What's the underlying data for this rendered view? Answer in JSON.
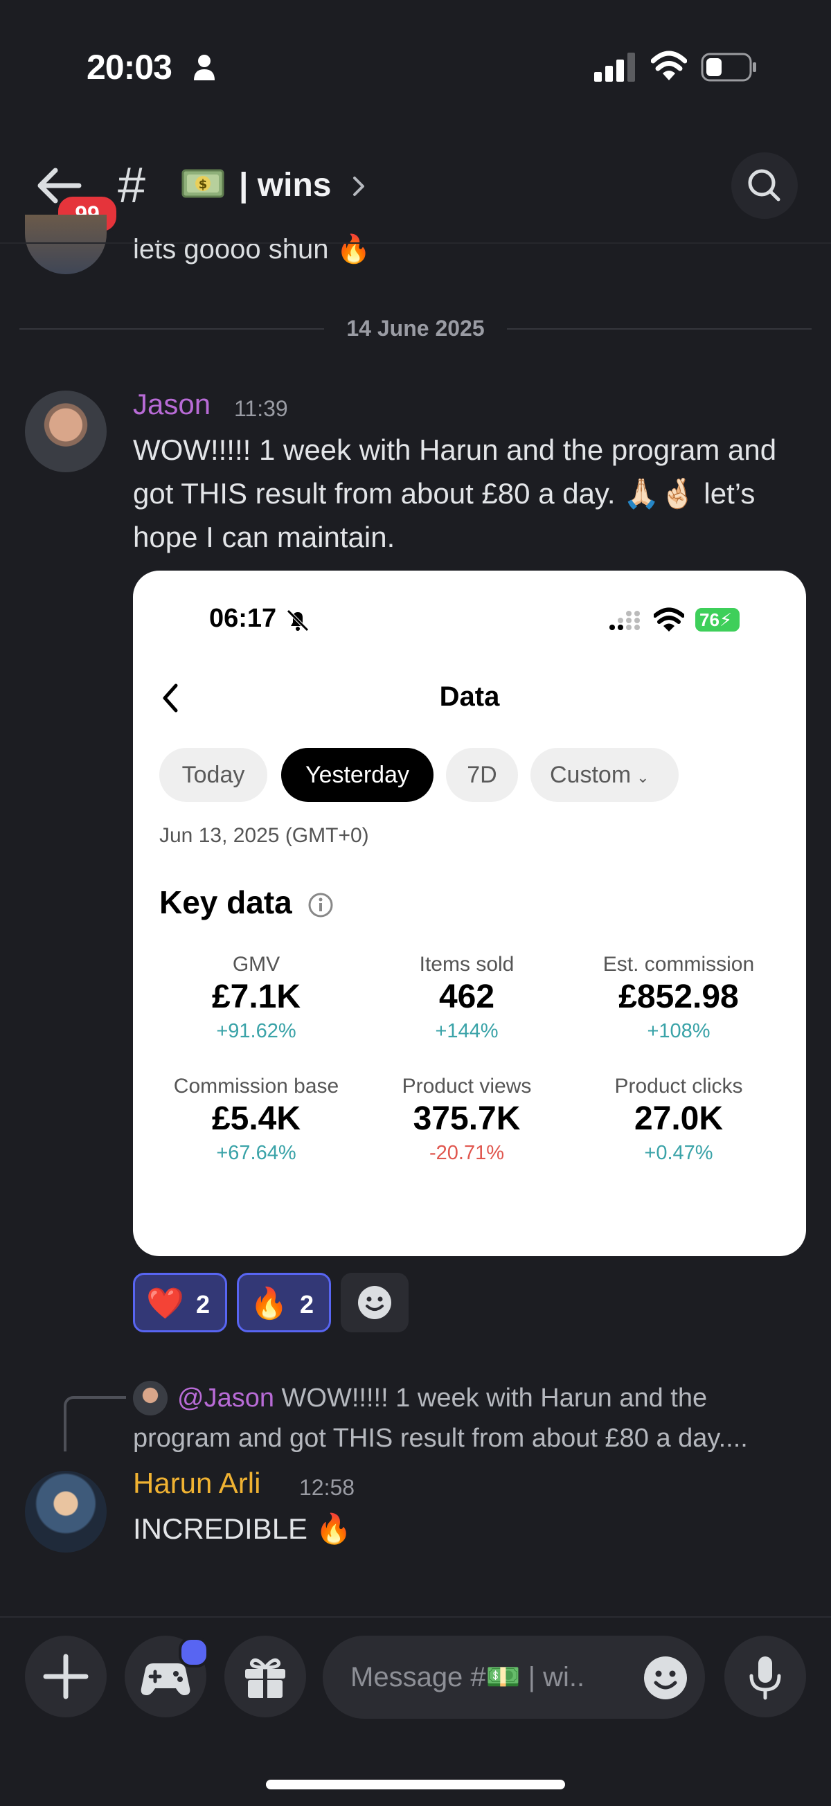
{
  "status_bar": {
    "time": "20:03"
  },
  "header": {
    "badge_count": "99",
    "hash": "#",
    "channel_name": "| wins"
  },
  "previous_message": {
    "text": "lets goooo shun 🔥"
  },
  "date_divider": "14 June 2025",
  "message1": {
    "author": "Jason",
    "author_color": "#b86bd6",
    "time": "11:39",
    "text": "WOW!!!!! 1 week with Harun and the program and got THIS result from about £80 a day. 🙏🏻🤞🏻 let’s hope I can maintain."
  },
  "screenshot": {
    "time": "06:17",
    "battery": "76",
    "title": "Data",
    "tabs": [
      "Today",
      "Yesterday",
      "7D",
      "Custom"
    ],
    "active_tab": "Yesterday",
    "date": "Jun 13, 2025 (GMT+0)",
    "section_title": "Key data",
    "metrics": [
      {
        "label": "GMV",
        "value": "£7.1K",
        "change": "+91.62%"
      },
      {
        "label": "Items sold",
        "value": "462",
        "change": "+144%"
      },
      {
        "label": "Est. commission",
        "value": "£852.98",
        "change": "+108%"
      },
      {
        "label": "Commission base",
        "value": "£5.4K",
        "change": "+67.64%"
      },
      {
        "label": "Product views",
        "value": "375.7K",
        "change": "-20.71%"
      },
      {
        "label": "Product clicks",
        "value": "27.0K",
        "change": "+0.47%"
      }
    ],
    "positive_color": "#3aa3a8",
    "negative_color": "#e0574f"
  },
  "reactions": [
    {
      "emoji": "❤️",
      "count": "2"
    },
    {
      "emoji": "🔥",
      "count": "2"
    }
  ],
  "reply": {
    "mention": "@Jason",
    "snippet": "WOW!!!!! 1 week with Harun and the program and got THIS result from about £80 a day...."
  },
  "message2": {
    "author": "Harun Arli",
    "author_color": "#f0b232",
    "time": "12:58",
    "text": "INCREDIBLE 🔥"
  },
  "composer": {
    "placeholder": "Message #💵 | wi.."
  }
}
